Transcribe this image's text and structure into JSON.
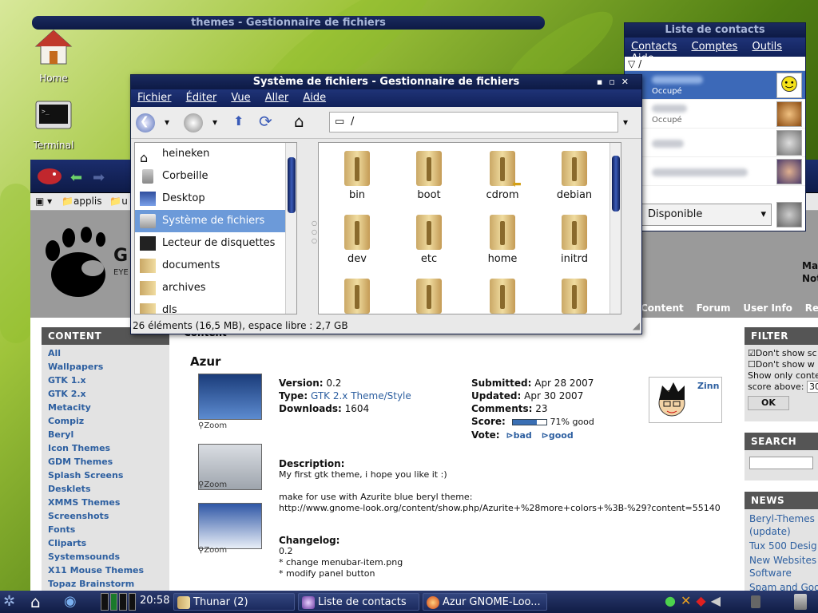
{
  "desktop": {
    "icons": [
      {
        "label": "Home"
      },
      {
        "label": "Terminal"
      }
    ]
  },
  "bg_window_title": "themes - Gestionnaire de fichiers",
  "browser": {
    "bookmarks": [
      "applis",
      "u"
    ],
    "nav": [
      "Content",
      "Forum",
      "User Info",
      "Regis"
    ],
    "header_partial": {
      "logo_text": "G",
      "logo_sub": "EYE",
      "right1": "May",
      "right2": "Not"
    },
    "left_heading": "CONTENT",
    "categories": [
      "All",
      "Wallpapers",
      "GTK 1.x",
      "GTK 2.x",
      "Metacity",
      "Compiz",
      "Beryl",
      "Icon Themes",
      "GDM Themes",
      "Splash Screens",
      "Desklets",
      "XMMS Themes",
      "Screenshots",
      "Fonts",
      "Cliparts",
      "Systemsounds",
      "X11 Mouse Themes",
      "Topaz Brainstorm"
    ],
    "tab": "Content",
    "item": {
      "title": "Azur",
      "version_label": "Version:",
      "version": "0.2",
      "type_label": "Type:",
      "type": "GTK 2.x Theme/Style",
      "downloads_label": "Downloads:",
      "downloads": "1604",
      "submitted_label": "Submitted:",
      "submitted": "Apr 28 2007",
      "updated_label": "Updated:",
      "updated": "Apr 30 2007",
      "comments_label": "Comments:",
      "comments": "23",
      "score_label": "Score:",
      "score_text": "71% good",
      "score_fraction": 0.71,
      "vote_label": "Vote:",
      "vote_bad": "bad",
      "vote_good": "good",
      "author": "Zinn",
      "zoom": "Zoom",
      "description_label": "Description:",
      "description": "My first gtk theme, i hope you like it :)",
      "note": "make for use with Azurite blue beryl theme:",
      "url": "http://www.gnome-look.org/content/show.php/Azurite+%28more+colors+%3B-%29?content=55140",
      "changelog_label": "Changelog:",
      "changelog": [
        "0.2",
        "* change menubar-item.png",
        "* modify panel button"
      ]
    },
    "filter": {
      "heading": "FILTER",
      "opt1": "Don't show sc",
      "opt2": "Don't show w",
      "line1": "Show only conte",
      "line2": "score above:",
      "score_value": "30",
      "ok": "OK"
    },
    "search_heading": "SEARCH",
    "news": {
      "heading": "NEWS",
      "items": [
        "Beryl-Themes",
        "(update)",
        "Tux 500 Desig",
        "New Websites",
        "Software",
        "Spam and Goo"
      ]
    }
  },
  "thunar": {
    "title": "Système de fichiers - Gestionnaire de fichiers",
    "menu": [
      "Fichier",
      "Éditer",
      "Vue",
      "Aller",
      "Aide"
    ],
    "location": "/",
    "sidebar": [
      "heineken",
      "Corbeille",
      "Desktop",
      "Système de fichiers",
      "Lecteur de disquettes",
      "documents",
      "archives",
      "dls"
    ],
    "selected_index": 3,
    "folders": [
      "bin",
      "boot",
      "cdrom",
      "debian",
      "dev",
      "etc",
      "home",
      "initrd"
    ],
    "status": "26 éléments (16,5 MB), espace libre : 2,7 GB"
  },
  "contacts": {
    "title": "Liste de contacts",
    "menu": [
      "Contacts",
      "Comptes",
      "Outils",
      "Aide"
    ],
    "path": "/",
    "statuses": [
      "Occupé",
      "Occupé"
    ],
    "status_select": "Disponible"
  },
  "taskbar": {
    "clock": "20:58",
    "tasks": [
      "Thunar (2)",
      "Liste de contacts",
      "Azur GNOME-Loo..."
    ]
  },
  "colors": {
    "accent": "#1a2a5e",
    "selection": "#6c9ad9",
    "link": "#2d5fa0"
  }
}
